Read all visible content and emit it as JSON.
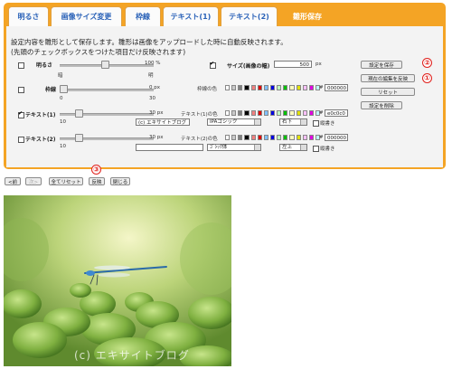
{
  "tabs": [
    {
      "label": "明るさ"
    },
    {
      "label": "画像サイズ変更"
    },
    {
      "label": "枠線"
    },
    {
      "label": "テキスト(1)"
    },
    {
      "label": "テキスト(2)"
    },
    {
      "label": "雛形保存"
    }
  ],
  "description": {
    "line1": "設定内容を雛形として保存します。雛形は画像をアップロードした時に自動反映されます。",
    "line2": "(先頭のチェックボックスをつけた項目だけ反映されます)"
  },
  "brightness": {
    "label": "明るさ",
    "value_text": "100 %",
    "min_label": "暗",
    "max_label": "明",
    "checked": false
  },
  "size": {
    "label": "サイズ(画像の幅)",
    "value": "500",
    "unit": "px",
    "checked": true
  },
  "border": {
    "label": "枠線",
    "value_text": "0 px",
    "min_label": "0",
    "max_label": "30",
    "color_label": "枠線の色",
    "hash": "#",
    "color_value": "000000",
    "checked": false
  },
  "text1": {
    "label": "テキスト(1)",
    "value_text": "30 px",
    "min_label": "10",
    "max_label": "80",
    "text_value": "(c) エキサイトブログ",
    "font": "IPAゴシック",
    "position": "右下",
    "vertical_label": "縦書き",
    "color_label": "テキスト(1)の色",
    "hash": "#",
    "color_value": "e0c0c0",
    "checked": true
  },
  "text2": {
    "label": "テキスト(2)",
    "value_text": "30 px",
    "min_label": "10",
    "max_label": "80",
    "text_value": "",
    "font": "ｺﾞｼｯｸ体",
    "position": "左上",
    "vertical_label": "縦書き",
    "color_label": "テキスト(2)の色",
    "hash": "#",
    "color_value": "000000",
    "checked": false
  },
  "side_buttons": {
    "save": "設定を保存",
    "apply_current": "現在の編集を反映",
    "reset": "リセット",
    "delete": "設定を削除"
  },
  "bottom_buttons": {
    "prev": "<前",
    "next": "次>",
    "reset_all": "全てリセット",
    "apply": "反映",
    "close": "閉じる"
  },
  "badges": {
    "one": "①",
    "two": "②",
    "three": "③"
  },
  "watermark": "(c) エキサイトブログ",
  "colors": {
    "accent": "#f4a425",
    "tab_text": "#2a62b8",
    "badge": "#e0201c",
    "swatches": [
      "#ffffff",
      "#c8c8c8",
      "#808080",
      "#000000",
      "#f08080",
      "#e00000",
      "#80c0ff",
      "#0000e0",
      "#c0ffc0",
      "#00c000",
      "#ffffc0",
      "#e0e000",
      "#ffc0ff",
      "#e000e0",
      "#c0ffff"
    ]
  }
}
